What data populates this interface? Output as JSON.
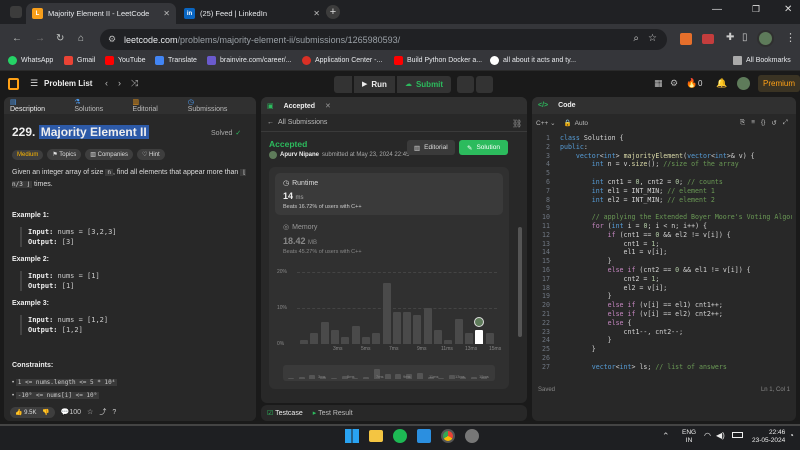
{
  "browser": {
    "tabs": [
      {
        "title": "Majority Element II - LeetCode",
        "active": true
      },
      {
        "title": "(25) Feed | LinkedIn",
        "active": false
      }
    ],
    "url_host": "leetcode.com",
    "url_path": "/problems/majority-element-ii/submissions/1265980593/",
    "bookmarks": [
      "WhatsApp",
      "Gmail",
      "YouTube",
      "Translate",
      "brainvire.com/career/...",
      "Application Center -...",
      "Build Python Docker a...",
      "all about it acts and ty..."
    ],
    "all_bookmarks": "All Bookmarks"
  },
  "lc": {
    "problem_list": "Problem List",
    "run": "Run",
    "submit": "Submit",
    "streak": "0",
    "premium": "Premium"
  },
  "left": {
    "tabs": [
      "Description",
      "Solutions",
      "Editorial",
      "Submissions"
    ],
    "title_num": "229.",
    "title": "Majority Element II",
    "solved": "Solved",
    "tags": [
      "Medium",
      "Topics",
      "Companies",
      "Hint"
    ],
    "desc1": "Given an integer array of size",
    "desc_n": "n",
    "desc2": ", find all elements that appear more than",
    "desc_frac": "⌊ n/3 ⌋",
    "desc3": "times.",
    "examples": [
      {
        "h": "Example 1:",
        "input": "nums = [3,2,3]",
        "output": "[3]"
      },
      {
        "h": "Example 2:",
        "input": "nums = [1]",
        "output": "[1]"
      },
      {
        "h": "Example 3:",
        "input": "nums = [1,2]",
        "output": "[1,2]"
      }
    ],
    "input_label": "Input:",
    "output_label": "Output:",
    "constraints_h": "Constraints:",
    "constraints": [
      "1 <= nums.length <= 5 * 10⁴",
      "-10⁹ <= nums[i] <= 10⁹"
    ],
    "likes": "9.5K",
    "comments": "100"
  },
  "mid": {
    "tab": "Accepted",
    "back": "All Submissions",
    "status": "Accepted",
    "count": "87 / 87 testcases passed",
    "author": "Apurv Nipane",
    "submitted": "submitted at May 23, 2024 22:45",
    "editorial": "Editorial",
    "solution": "Solution",
    "runtime_label": "Runtime",
    "runtime_val": "14",
    "runtime_unit": "ms",
    "runtime_beats": "Beats 16.72% of users with C++",
    "memory_label": "Memory",
    "memory_val": "18.42",
    "memory_unit": "MB",
    "memory_beats": "Beats 45.27% of users with C++",
    "y_ticks": [
      "20%",
      "10%",
      "0%"
    ],
    "x_ticks": [
      "3ms",
      "5ms",
      "7ms",
      "9ms",
      "11ms",
      "13ms",
      "15ms"
    ],
    "mini_x_ticks": [
      "3ms",
      "5ms",
      "7ms",
      "9ms",
      "11ms",
      "13ms",
      "15ms"
    ],
    "testcase": "Testcase",
    "test_result": "Test Result"
  },
  "chart_data": {
    "type": "bar",
    "values": [
      1,
      3,
      6,
      4,
      2,
      5,
      2,
      3,
      17,
      9,
      9,
      8,
      10,
      4,
      1,
      7,
      3,
      4,
      3
    ],
    "highlight_index": 17,
    "ylim": [
      0,
      20
    ],
    "yunit": "%"
  },
  "right": {
    "tab": "Code",
    "lang": "C++",
    "auto": "Auto",
    "saved": "Saved",
    "pos": "Ln 1, Col 1"
  },
  "taskbar": {
    "lang": "ENG",
    "region": "IN",
    "time": "22:46",
    "date": "23-05-2024"
  }
}
